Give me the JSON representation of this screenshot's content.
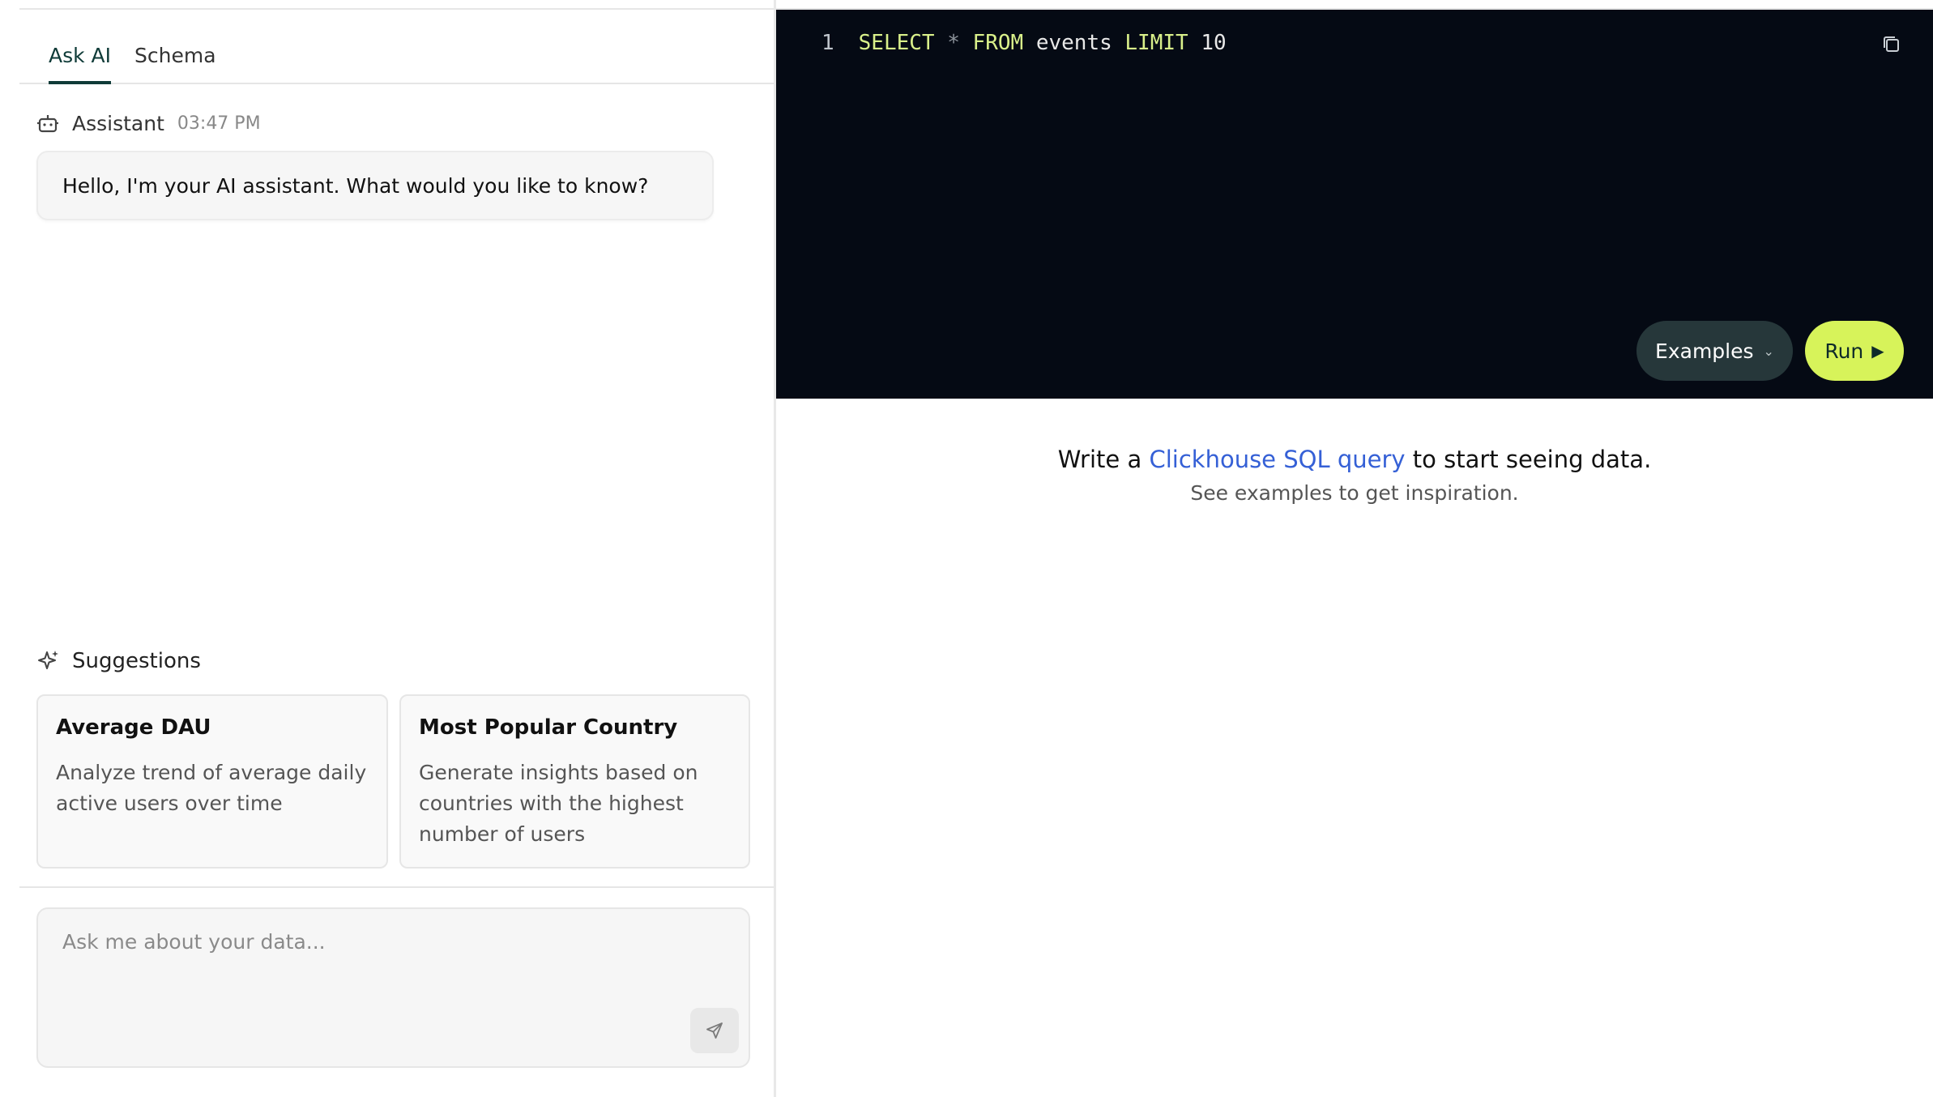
{
  "tabs": [
    {
      "label": "Ask AI",
      "active": true
    },
    {
      "label": "Schema",
      "active": false
    }
  ],
  "message": {
    "author": "Assistant",
    "time": "03:47 PM",
    "text": "Hello, I'm your AI assistant. What would you like to know?",
    "icon": "bot-icon"
  },
  "suggestions": {
    "title": "Suggestions",
    "icon": "sparkle-icon",
    "cards": [
      {
        "title": "Average DAU",
        "description": "Analyze trend of average daily active users over time"
      },
      {
        "title": "Most Popular Country",
        "description": "Generate insights based on countries with the highest number of users"
      }
    ]
  },
  "composer": {
    "placeholder": "Ask me about your data...",
    "value": "",
    "send_icon": "send-icon"
  },
  "editor": {
    "line_number": "1",
    "tokens": {
      "select": "SELECT",
      "star": "*",
      "from": "FROM",
      "table": "events",
      "limit": "LIMIT",
      "count": "10"
    },
    "copy_icon": "copy-icon",
    "examples_label": "Examples",
    "run_label": "Run"
  },
  "empty_state": {
    "prefix": "Write a ",
    "link": "Clickhouse SQL query",
    "suffix": " to start seeing data.",
    "subtitle": "See examples to get inspiration."
  },
  "colors": {
    "accent_dark": "#0f3b38",
    "run_button": "#d7f35a",
    "editor_bg": "#050a14",
    "link": "#3560d6"
  }
}
